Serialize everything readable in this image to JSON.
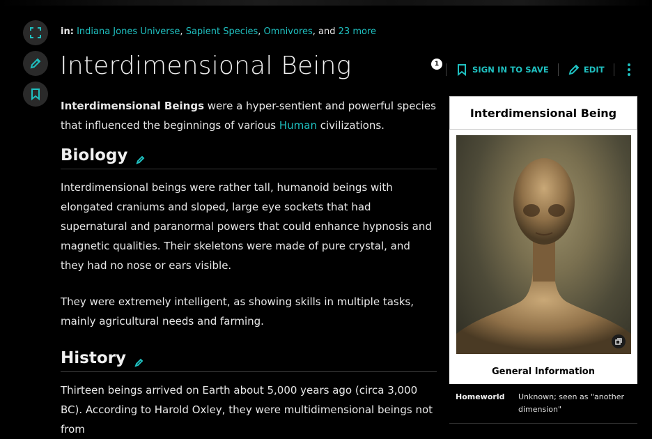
{
  "categories": {
    "prefix": "in:",
    "items": [
      "Indiana Jones Universe",
      "Sapient Species",
      "Omnivores"
    ],
    "conj": ", and",
    "more": "23 more"
  },
  "page": {
    "title": "Interdimensional Being"
  },
  "actions": {
    "comment_count": "1",
    "sign_in_to_save": "SIGN IN TO SAVE",
    "edit": "EDIT"
  },
  "intro": {
    "bold": "Interdimensional Beings",
    "text1": " were a hyper-sentient and powerful species that influenced the beginnings of various ",
    "link": "Human",
    "text2": " civilizations."
  },
  "sections": {
    "biology": {
      "heading": "Biology",
      "p1": "Interdimensional beings were rather tall, humanoid beings with elongated craniums and sloped, large eye sockets that had supernatural and paranormal powers that could enhance hypnosis and magnetic qualities. Their skeletons were made of pure crystal, and they had no nose or ears visible.",
      "p2": "They were extremely intelligent, as showing skills in multiple tasks, mainly agricultural needs and farming."
    },
    "history": {
      "heading": "History",
      "p1": "Thirteen beings arrived on Earth about 5,000 years ago (circa 3,000 BC). According to Harold Oxley, they were multidimensional beings not from"
    }
  },
  "infobox": {
    "title": "Interdimensional Being",
    "section": "General Information",
    "rows": [
      {
        "label": "Homeworld",
        "value": "Unknown; seen as \"another dimension\""
      }
    ]
  },
  "colors": {
    "accent": "#1fc0c0",
    "background": "#000000",
    "text": "#e8e8e8"
  }
}
